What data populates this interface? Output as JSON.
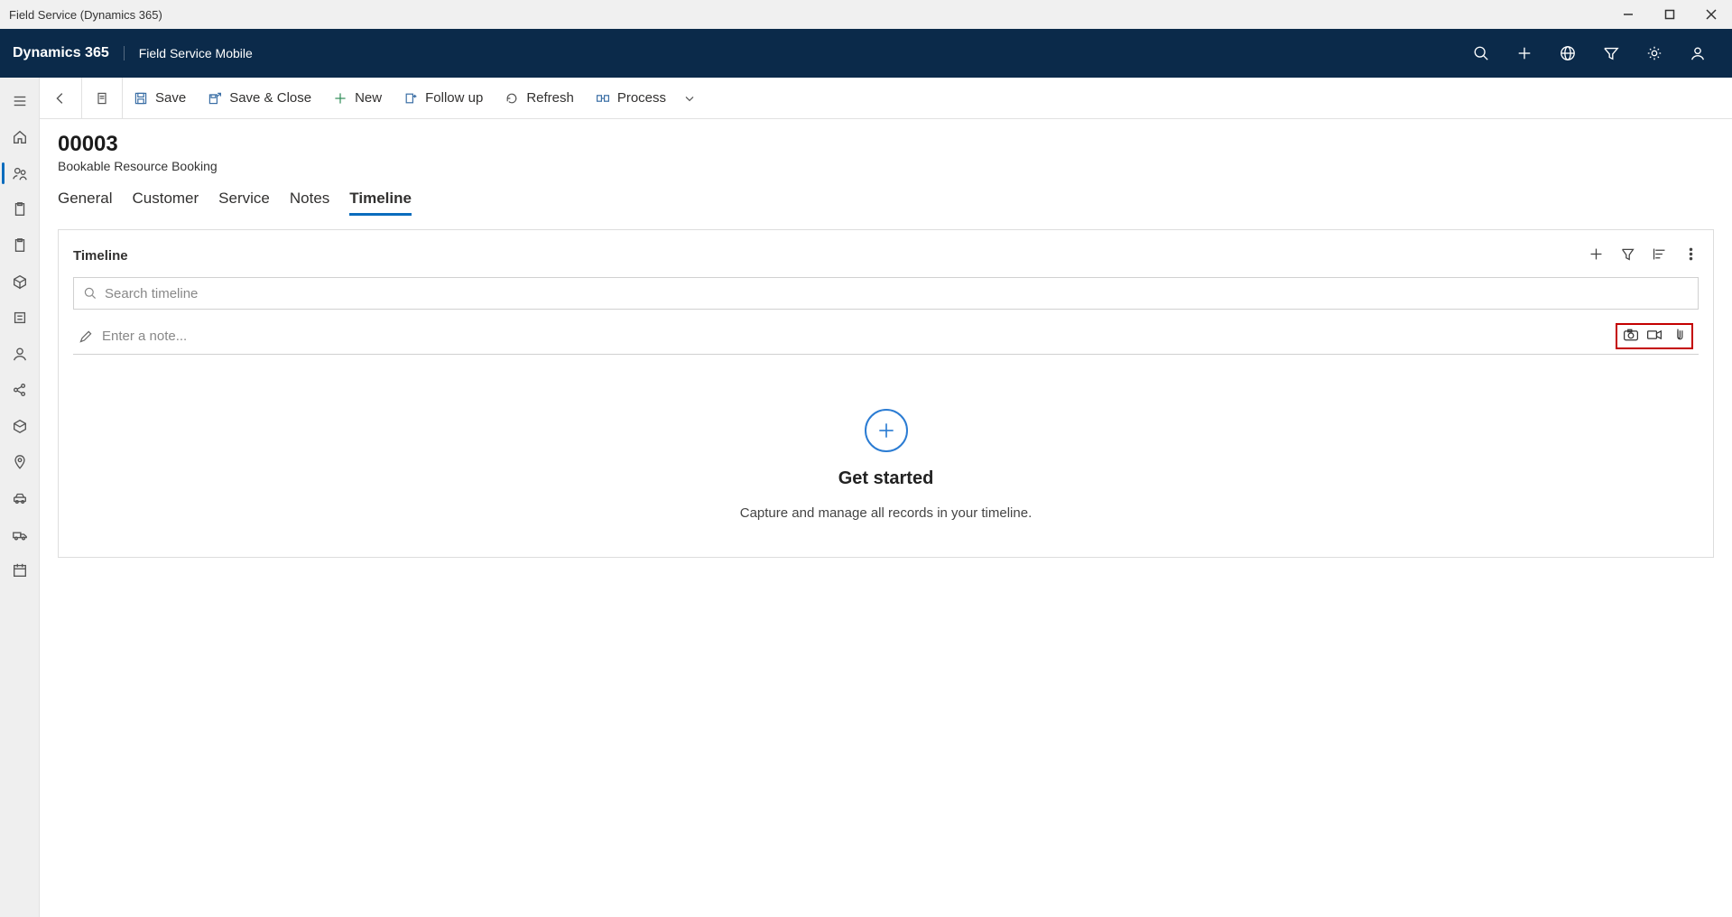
{
  "window": {
    "title": "Field Service (Dynamics 365)"
  },
  "appbar": {
    "brand": "Dynamics 365",
    "title": "Field Service Mobile"
  },
  "commands": {
    "save": "Save",
    "save_close": "Save & Close",
    "new": "New",
    "follow_up": "Follow up",
    "refresh": "Refresh",
    "process": "Process"
  },
  "record": {
    "id": "00003",
    "type": "Bookable Resource Booking"
  },
  "tabs": {
    "items": [
      "General",
      "Customer",
      "Service",
      "Notes",
      "Timeline"
    ],
    "active": "Timeline"
  },
  "timeline": {
    "title": "Timeline",
    "search_placeholder": "Search timeline",
    "note_placeholder": "Enter a note...",
    "empty_title": "Get started",
    "empty_sub": "Capture and manage all records in your timeline."
  }
}
